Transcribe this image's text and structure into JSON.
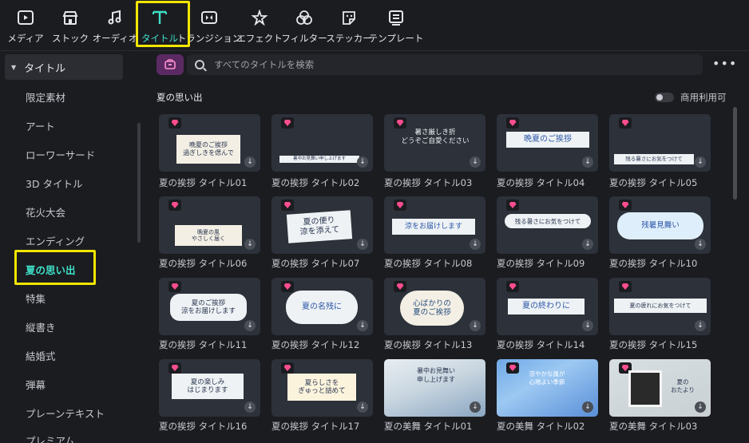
{
  "toolbar": {
    "items": [
      {
        "label": "メディア",
        "icon": "media-icon"
      },
      {
        "label": "ストック",
        "icon": "stock-icon"
      },
      {
        "label": "オーディオ",
        "icon": "audio-icon"
      },
      {
        "label": "タイトル",
        "icon": "title-icon",
        "active": true
      },
      {
        "label": "トランジション",
        "icon": "transition-icon"
      },
      {
        "label": "エフェクト",
        "icon": "effect-icon"
      },
      {
        "label": "フィルター",
        "icon": "filter-icon"
      },
      {
        "label": "ステッカー",
        "icon": "sticker-icon"
      },
      {
        "label": "テンプレート",
        "icon": "template-icon"
      }
    ]
  },
  "sidebar": {
    "header": "タイトル",
    "items": [
      "限定素材",
      "アート",
      "ローワーサード",
      "3D タイトル",
      "花火大会",
      "エンディング",
      "夏の思い出",
      "特集",
      "縦書き",
      "結婚式",
      "弾幕",
      "プレーンテキスト",
      "プレミアム"
    ],
    "active_index": 6
  },
  "search": {
    "placeholder": "すべてのタイトルを検索"
  },
  "section": {
    "title": "夏の思い出",
    "toggle_label": "商用利用可"
  },
  "cards": [
    {
      "label": "夏の挨拶 タイトル01",
      "text": "晩夏のご挨拶\n過ぎしきを偲んで"
    },
    {
      "label": "夏の挨拶 タイトル02",
      "text": "暑中お見舞い申し上げます"
    },
    {
      "label": "夏の挨拶 タイトル03",
      "text": "暑さ厳しき折\nどうぞご自愛ください"
    },
    {
      "label": "夏の挨拶 タイトル04",
      "text": "晩夏のご挨拶"
    },
    {
      "label": "夏の挨拶 タイトル05",
      "text": "残る暑さにお気をつけて"
    },
    {
      "label": "夏の挨拶 タイトル06",
      "text": "晩夏の風\nやさしく届く"
    },
    {
      "label": "夏の挨拶 タイトル07",
      "text": "夏の便り\n涼を添えて"
    },
    {
      "label": "夏の挨拶 タイトル08",
      "text": "涼をお届けします"
    },
    {
      "label": "夏の挨拶 タイトル09",
      "text": "残る暑さにお気をつけて"
    },
    {
      "label": "夏の挨拶 タイトル10",
      "text": "残暑見舞い"
    },
    {
      "label": "夏の挨拶 タイトル11",
      "text": "夏のご挨拶\n涼をお届けします"
    },
    {
      "label": "夏の挨拶 タイトル12",
      "text": "夏の名残に"
    },
    {
      "label": "夏の挨拶 タイトル13",
      "text": "心ばかりの\n夏のご挨拶"
    },
    {
      "label": "夏の挨拶 タイトル14",
      "text": "夏の終わりに"
    },
    {
      "label": "夏の挨拶 タイトル15",
      "text": "夏の疲れにお気をつけて"
    },
    {
      "label": "夏の挨拶 タイトル16",
      "text": "夏の楽しみ\nはじまります"
    },
    {
      "label": "夏の挨拶 タイトル17",
      "text": "夏らしさを\nぎゅっと詰めて"
    },
    {
      "label": "夏の美舞 タイトル01",
      "text": "暑中お見舞い\n申し上げます"
    },
    {
      "label": "夏の美舞 タイトル02",
      "text": "涼やかな風が\n心地よい季節"
    },
    {
      "label": "夏の美舞 タイトル03",
      "text": "夏の\nおたより"
    }
  ],
  "colors": {
    "accent": "#3ee0c8",
    "highlight": "#f2e600",
    "premium": "#ff4d8f"
  }
}
